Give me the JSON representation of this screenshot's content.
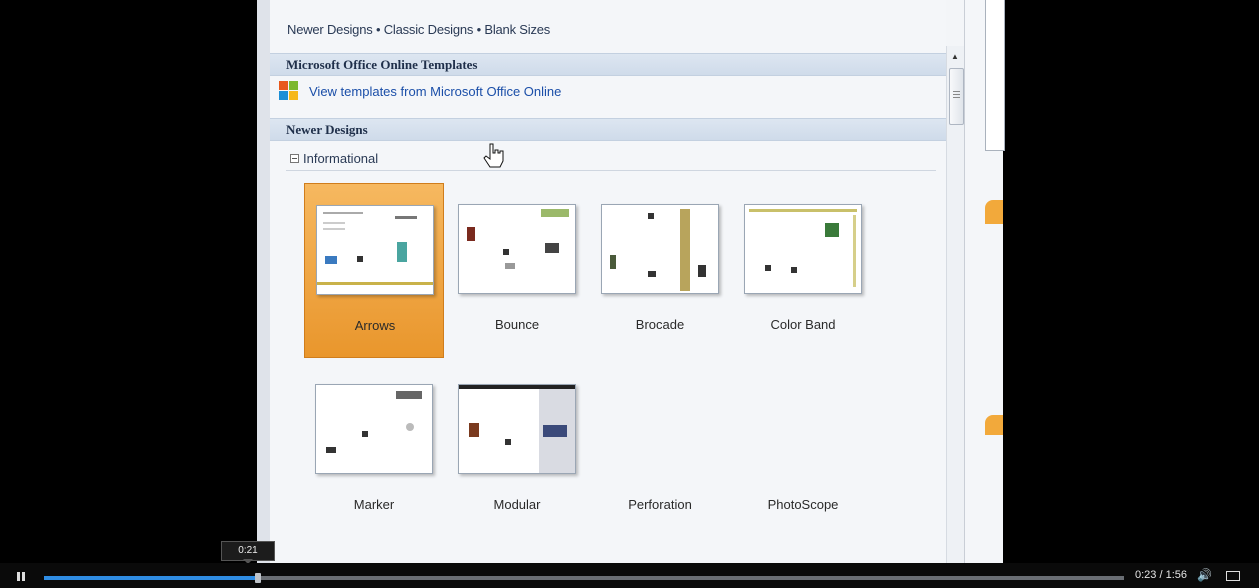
{
  "nav": {
    "text": "Newer Designs • Classic Designs • Blank Sizes"
  },
  "sections": {
    "online": {
      "title": "Microsoft Office Online Templates",
      "link": "View templates from Microsoft Office Online"
    },
    "newer": {
      "title": "Newer Designs",
      "group": "Informational"
    }
  },
  "templates": [
    {
      "label": "Arrows",
      "selected": true
    },
    {
      "label": "Bounce"
    },
    {
      "label": "Brocade"
    },
    {
      "label": "Color Band"
    },
    {
      "label": "Marker"
    },
    {
      "label": "Modular"
    },
    {
      "label": "Perforation"
    },
    {
      "label": "PhotoScope"
    }
  ],
  "player": {
    "current_time": "0:23",
    "separator": "/",
    "duration": "1:56",
    "hover_time": "0:21",
    "progress_fraction": 0.198,
    "accent_color": "#2f8de4"
  },
  "colors": {
    "selected_tile": "#eea03a",
    "band": "#d5e0ee",
    "link": "#1a4ea8"
  }
}
